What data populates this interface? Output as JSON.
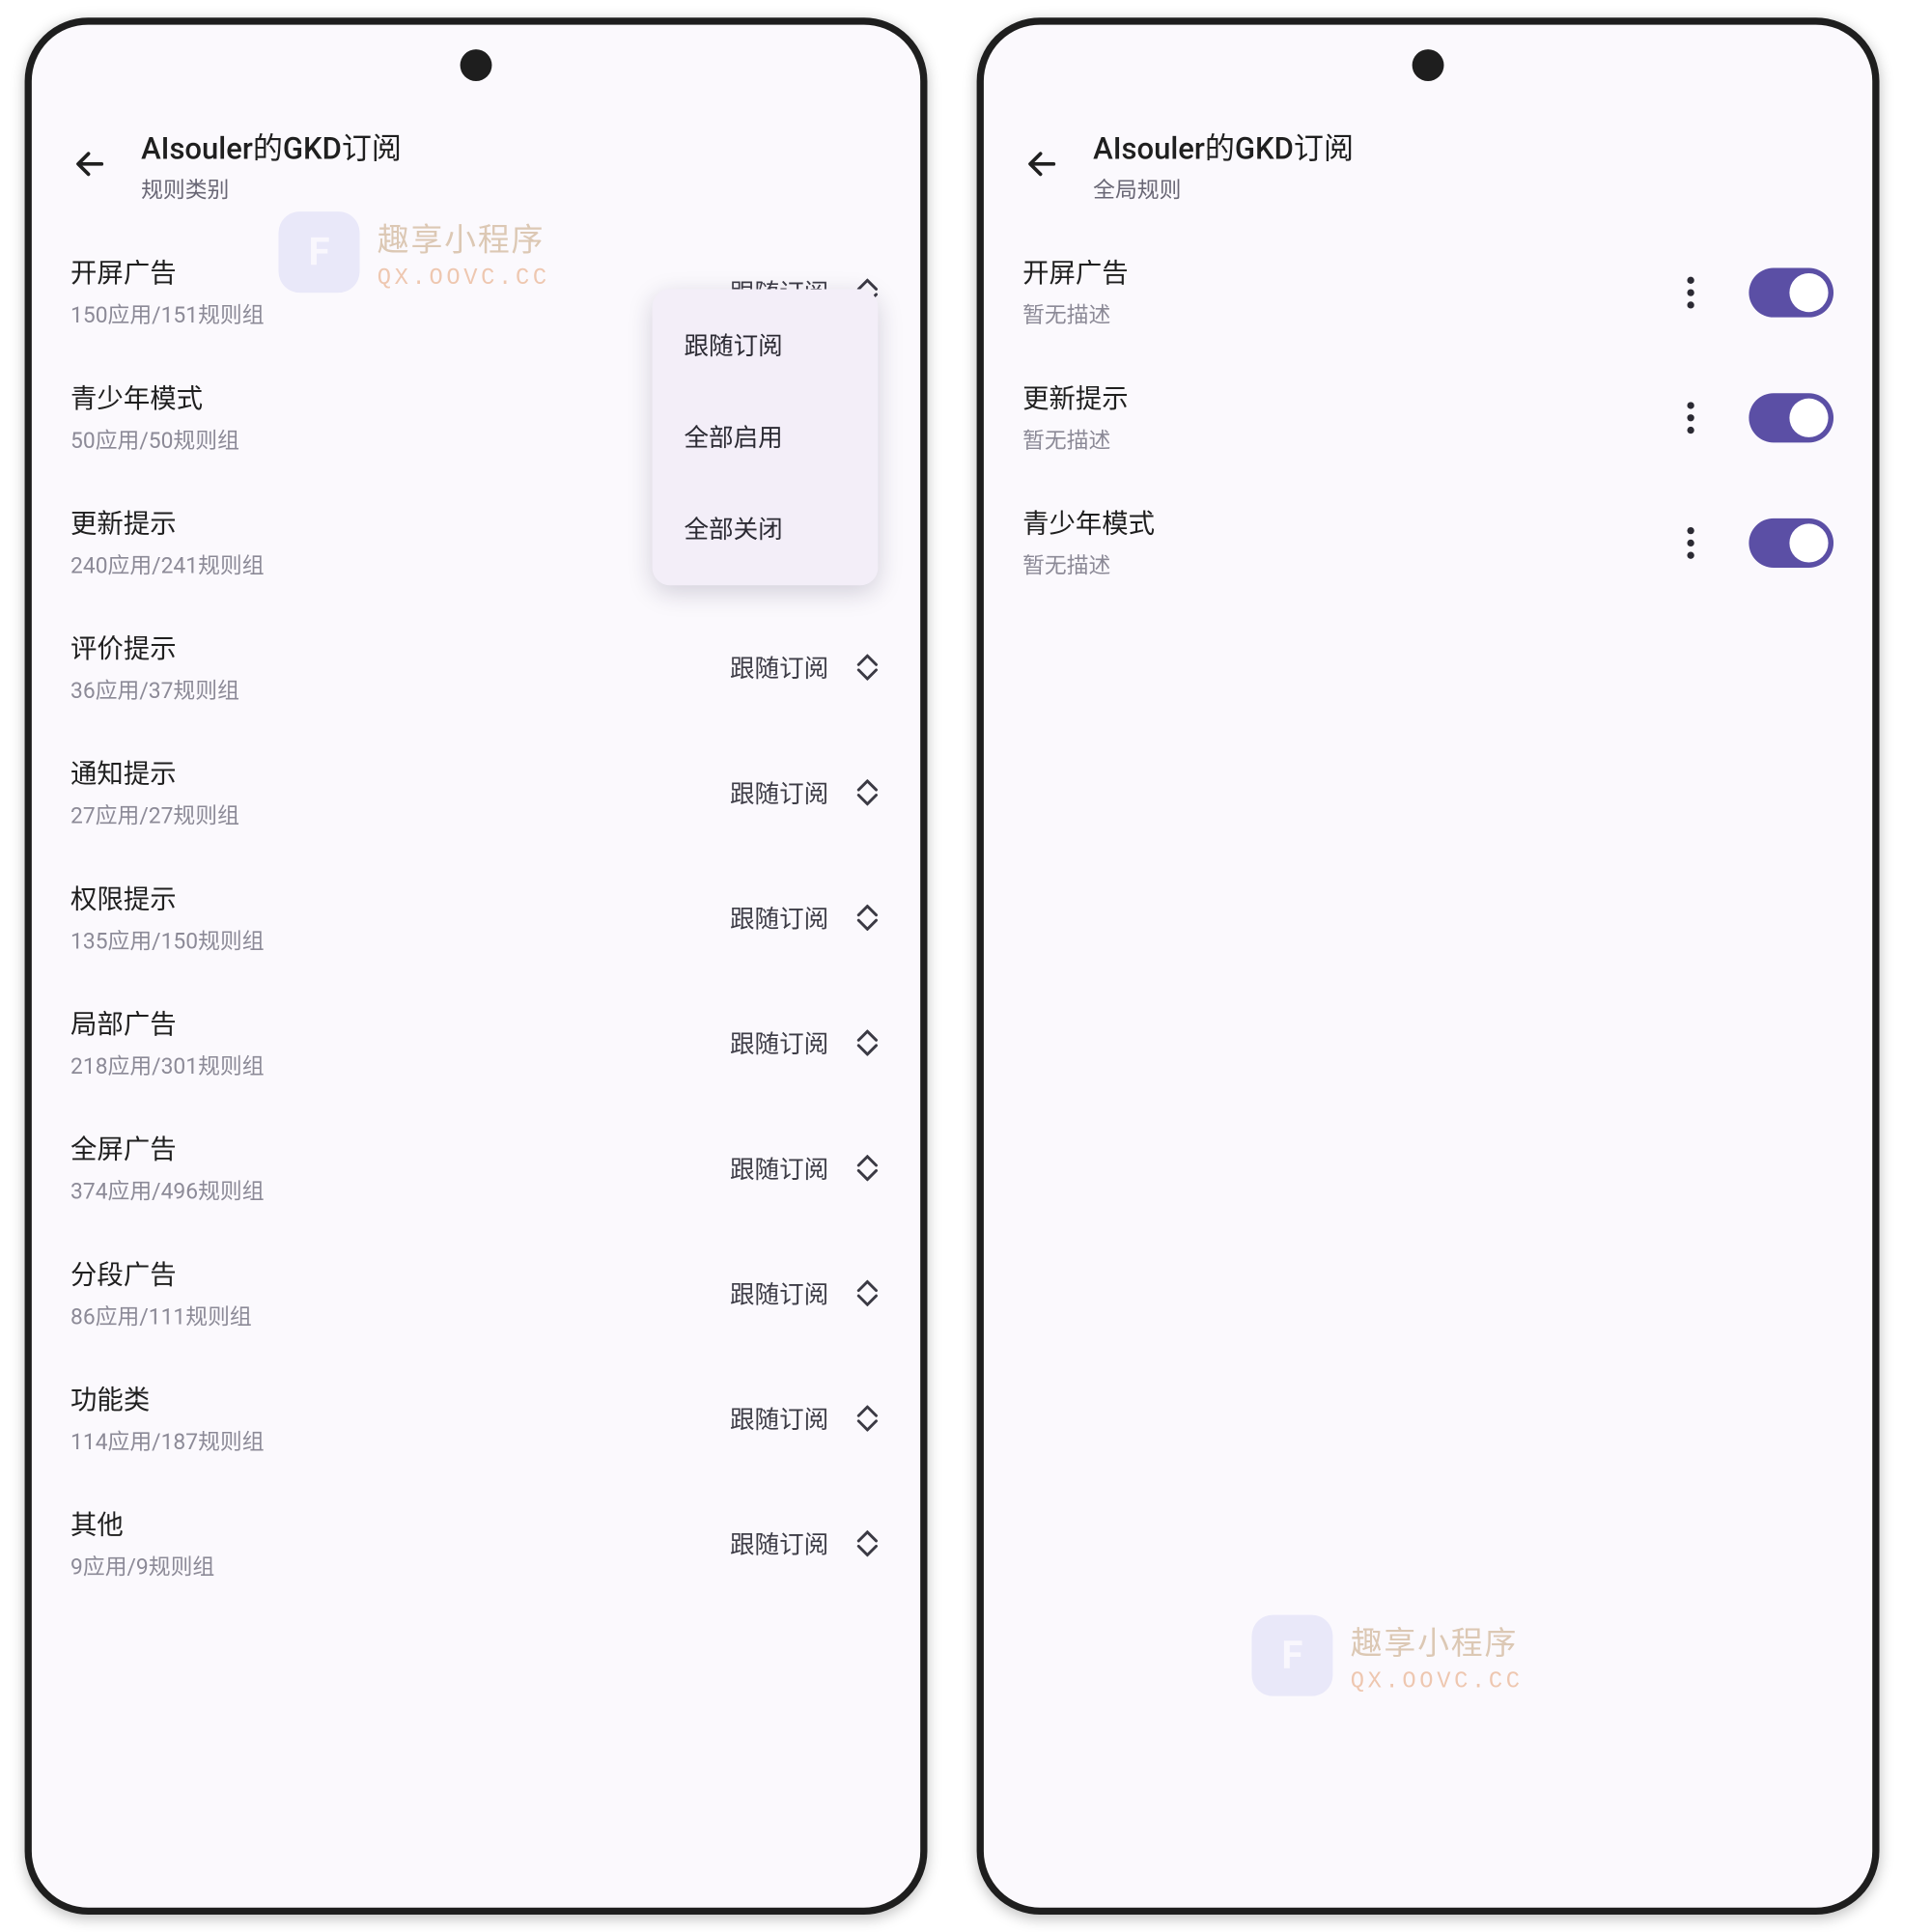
{
  "phones": [
    {
      "header": {
        "title": "AIsouler的GKD订阅",
        "subtitle": "规则类别"
      },
      "rows": [
        {
          "title": "开屏广告",
          "sub": "150应用/151规则组",
          "value": "跟随订阅"
        },
        {
          "title": "青少年模式",
          "sub": "50应用/50规则组",
          "value": ""
        },
        {
          "title": "更新提示",
          "sub": "240应用/241规则组",
          "value": ""
        },
        {
          "title": "评价提示",
          "sub": "36应用/37规则组",
          "value": "跟随订阅"
        },
        {
          "title": "通知提示",
          "sub": "27应用/27规则组",
          "value": "跟随订阅"
        },
        {
          "title": "权限提示",
          "sub": "135应用/150规则组",
          "value": "跟随订阅"
        },
        {
          "title": "局部广告",
          "sub": "218应用/301规则组",
          "value": "跟随订阅"
        },
        {
          "title": "全屏广告",
          "sub": "374应用/496规则组",
          "value": "跟随订阅"
        },
        {
          "title": "分段广告",
          "sub": "86应用/111规则组",
          "value": "跟随订阅"
        },
        {
          "title": "功能类",
          "sub": "114应用/187规则组",
          "value": "跟随订阅"
        },
        {
          "title": "其他",
          "sub": "9应用/9规则组",
          "value": "跟随订阅"
        }
      ],
      "dropdown": {
        "options": [
          "跟随订阅",
          "全部启用",
          "全部关闭"
        ]
      }
    },
    {
      "header": {
        "title": "AIsouler的GKD订阅",
        "subtitle": "全局规则"
      },
      "rows": [
        {
          "title": "开屏广告",
          "sub": "暂无描述",
          "on": true
        },
        {
          "title": "更新提示",
          "sub": "暂无描述",
          "on": true
        },
        {
          "title": "青少年模式",
          "sub": "暂无描述",
          "on": true
        }
      ]
    }
  ],
  "watermark": {
    "title": "趣享小程序",
    "url": "QX.OOVC.CC"
  }
}
